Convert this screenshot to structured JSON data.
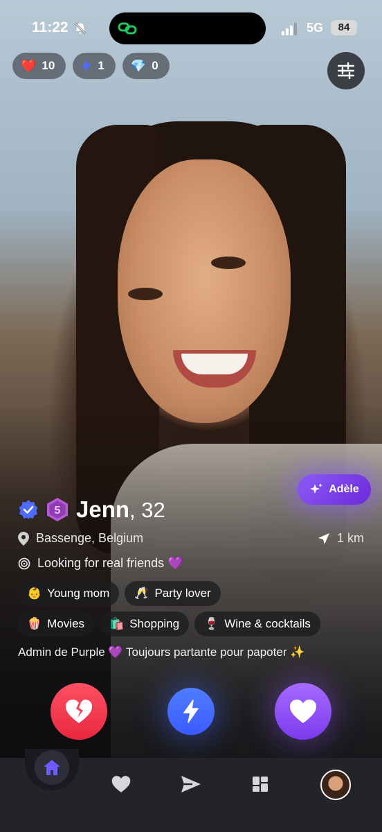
{
  "status_bar": {
    "time": "11:22",
    "network": "5G",
    "battery": "84"
  },
  "counters": [
    {
      "icon": "heart-icon",
      "glyph": "❤️",
      "value": "10"
    },
    {
      "icon": "lightning-icon",
      "glyph": "⚡",
      "value": "1"
    },
    {
      "icon": "diamond-icon",
      "glyph": "💎",
      "value": "0"
    }
  ],
  "ai_chip": {
    "label": "Adèle"
  },
  "profile": {
    "name": "Jenn",
    "age_text": ", 32",
    "level": "5",
    "location": "Bassenge, Belgium",
    "distance": "1 km",
    "looking_for": "Looking for real friends 💜",
    "tags_row1": [
      {
        "emoji": "👶",
        "label": "Young mom"
      },
      {
        "emoji": "🥂",
        "label": "Party lover"
      }
    ],
    "tags_row2": [
      {
        "emoji": "🍿",
        "label": "Movies"
      },
      {
        "emoji": "🛍️",
        "label": "Shopping"
      },
      {
        "emoji": "🍷",
        "label": "Wine & cocktails"
      }
    ],
    "bio": "Admin de Purple 💜  Toujours partante pour papoter ✨"
  },
  "colors": {
    "pass": "#e8283f",
    "boost": "#3b5bff",
    "like": "#7c3aed",
    "accent": "#8b5cf6",
    "nav_bg": "#23232a"
  }
}
